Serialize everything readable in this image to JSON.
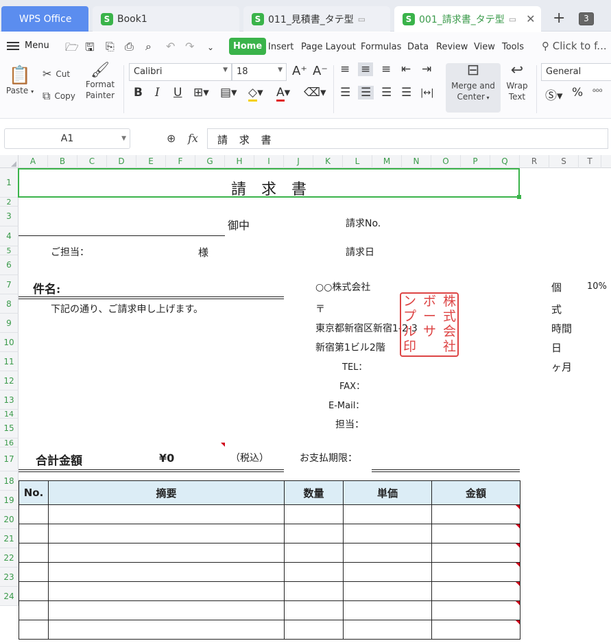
{
  "tabs": {
    "wps": "WPS Office",
    "book1": "Book1",
    "quote": "011_見積書_タテ型",
    "invoice": "001_請求書_タテ型",
    "count": "3"
  },
  "menu": {
    "menu_label": "Menu",
    "tabs": [
      "Home",
      "Insert",
      "Page Layout",
      "Formulas",
      "Data",
      "Review",
      "View",
      "Tools"
    ],
    "search_placeholder": "Click to f..."
  },
  "ribbon": {
    "paste": "Paste",
    "cut": "Cut",
    "copy": "Copy",
    "format_painter_1": "Format",
    "format_painter_2": "Painter",
    "font_name": "Calibri",
    "font_size": "18",
    "merge_1": "Merge and",
    "merge_2": "Center",
    "wrap_1": "Wrap",
    "wrap_2": "Text",
    "number_format": "General"
  },
  "formula_bar": {
    "cell_ref": "A1",
    "content": "請 求 書"
  },
  "grid": {
    "columns": [
      "A",
      "B",
      "C",
      "D",
      "E",
      "F",
      "G",
      "H",
      "I",
      "J",
      "K",
      "L",
      "M",
      "N",
      "O",
      "P",
      "Q",
      "R",
      "S",
      "T"
    ],
    "rows": [
      "1",
      "2",
      "3",
      "4",
      "5",
      "6",
      "7",
      "8",
      "9",
      "10",
      "11",
      "12",
      "13",
      "14",
      "15",
      "16",
      "17",
      "18",
      "19",
      "20",
      "21",
      "22",
      "23",
      "24"
    ]
  },
  "sheet": {
    "title": "請　求　書",
    "onchu": "御中",
    "tantou_label": "ご担当：",
    "sama": "様",
    "invoice_no": "請求No.",
    "invoice_date": "請求日",
    "subject": "件名:",
    "intro": "下記の通り、ご請求申し上げます。",
    "company": "○○株式会社",
    "postal": "〒",
    "address1": "東京都新宿区新宿1-2-3",
    "address2": "新宿第1ビル2階",
    "tel": "TEL：",
    "fax": "FAX：",
    "email": "E-Mail：",
    "staff": "担当：",
    "total_label": "合計金額",
    "total_value": "¥0",
    "tax_incl": "（税込）",
    "due_label": "お支払期限：",
    "side_units": [
      "個",
      "式",
      "時間",
      "日",
      "ヶ月"
    ],
    "tax_rate": "10%",
    "table_headers": [
      "No.",
      "摘要",
      "数量",
      "単価",
      "金額"
    ],
    "stamp_chars": [
      "株",
      "式",
      "会",
      "社",
      "ボ",
      "ー",
      "サ",
      "ン",
      "プ",
      "ル",
      "印"
    ]
  }
}
